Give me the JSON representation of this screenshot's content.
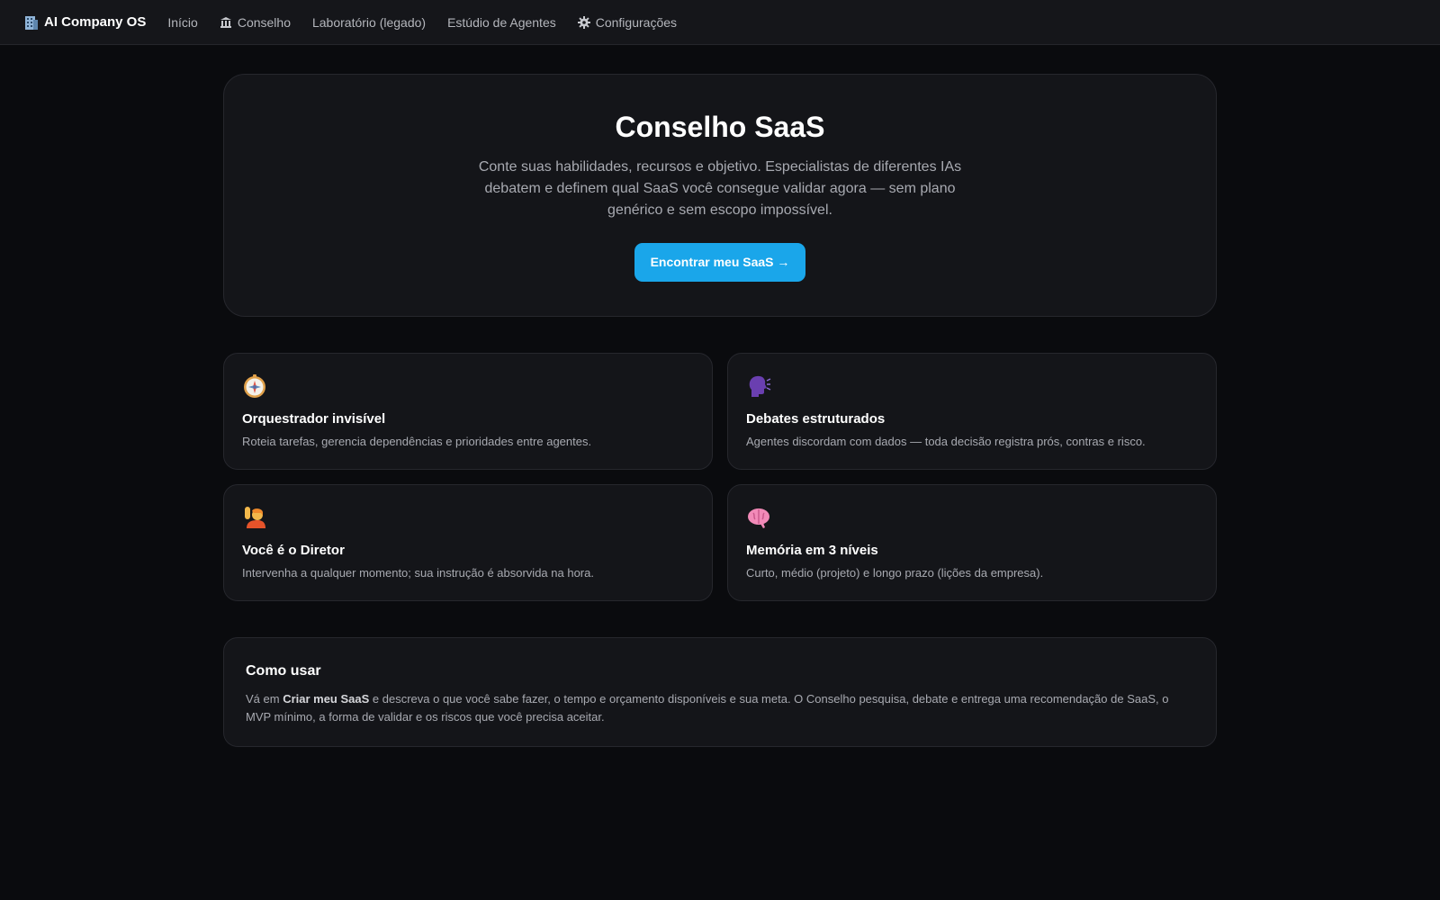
{
  "nav": {
    "brand": "AI Company OS",
    "brand_icon": "office-building-icon",
    "items": [
      {
        "label": "Início"
      },
      {
        "label": "Conselho",
        "icon": "bank-building-icon"
      },
      {
        "label": "Laboratório (legado)"
      },
      {
        "label": "Estúdio de Agentes"
      },
      {
        "label": "Configurações",
        "icon": "gear-icon"
      }
    ]
  },
  "hero": {
    "title": "Conselho SaaS",
    "subtitle": "Conte suas habilidades, recursos e objetivo. Especialistas de diferentes IAs debatem e definem qual SaaS você consegue validar agora — sem plano genérico e sem escopo impossível.",
    "cta_label": "Encontrar meu SaaS →"
  },
  "features": [
    {
      "icon": "compass-icon",
      "title": "Orquestrador invisível",
      "description": "Roteia tarefas, gerencia dependências e prioridades entre agentes."
    },
    {
      "icon": "speaking-head-icon",
      "title": "Debates estruturados",
      "description": "Agentes discordam com dados — toda decisão registra prós, contras e risco."
    },
    {
      "icon": "raising-hand-person-icon",
      "title": "Você é o Diretor",
      "description": "Intervenha a qualquer momento; sua instrução é absorvida na hora."
    },
    {
      "icon": "brain-icon",
      "title": "Memória em 3 níveis",
      "description": "Curto, médio (projeto) e longo prazo (lições da empresa)."
    }
  ],
  "howto": {
    "title": "Como usar",
    "text_before": "Vá em ",
    "text_bold": "Criar meu SaaS",
    "text_after": " e descreva o que você sabe fazer, o tempo e orçamento disponíveis e sua meta. O Conselho pesquisa, debate e entrega uma recomendação de SaaS, o MVP mínimo, a forma de validar e os riscos que você precisa aceitar."
  },
  "colors": {
    "background": "#0a0b0e",
    "card": "#141519",
    "accent": "#1aa6ea"
  }
}
